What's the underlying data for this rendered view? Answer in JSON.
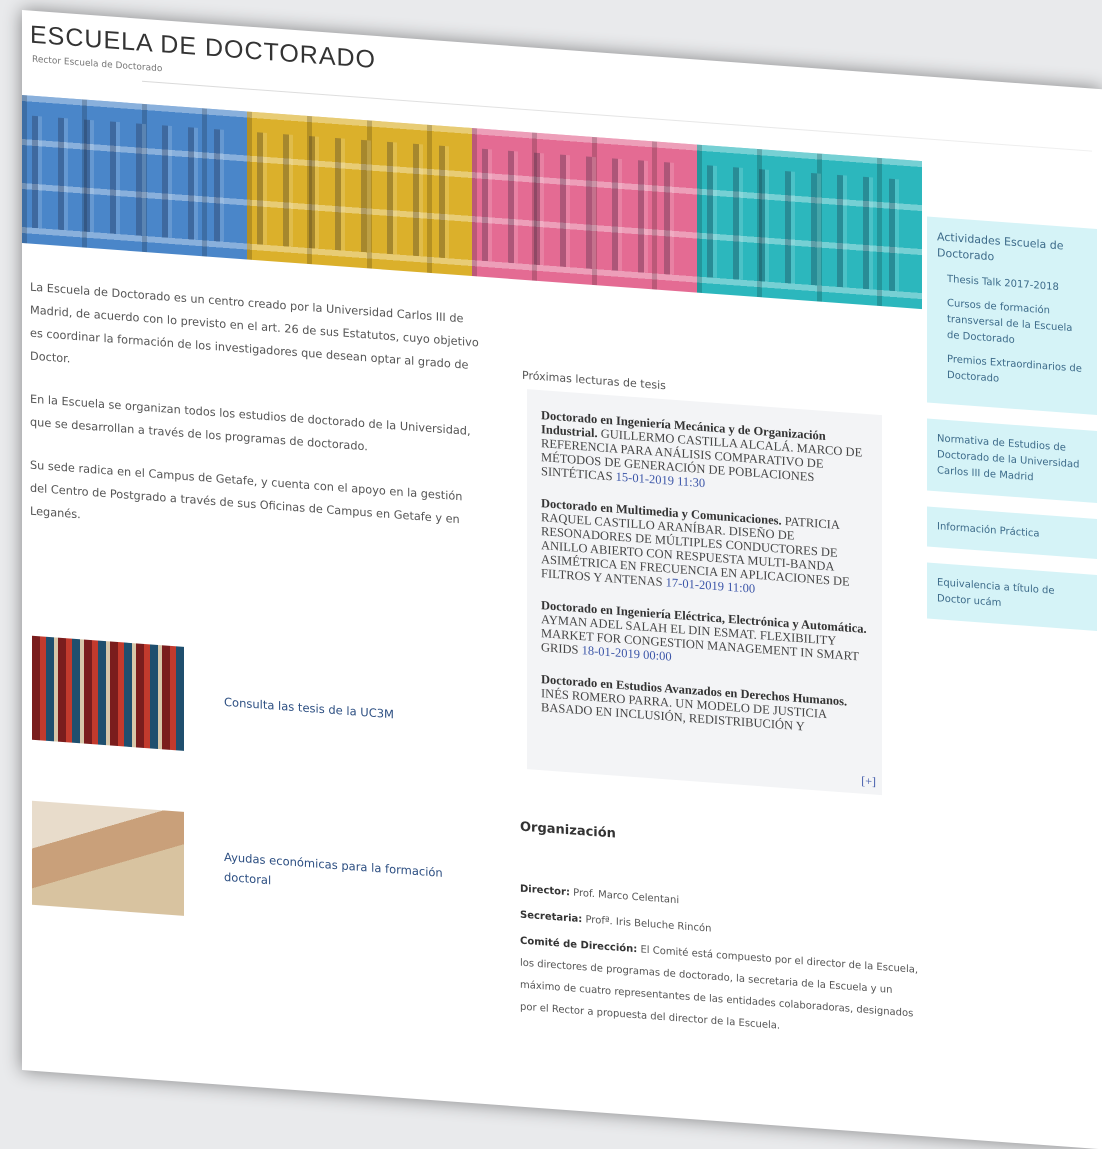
{
  "header": {
    "title": "ESCUELA DE DOCTORADO",
    "subtitle": "Rector Escuela de Doctorado"
  },
  "banner": {
    "colors": [
      "#4a86c9",
      "#dbb02b",
      "#e46b93",
      "#2cb7bd"
    ]
  },
  "intro": {
    "p1": "La Escuela de Doctorado es un centro creado por la Universidad Carlos III de Madrid, de acuerdo con lo previsto en el art. 26 de sus Estatutos, cuyo objetivo es coordinar la formación de los investigadores que desean optar al grado de Doctor.",
    "p2": "En la Escuela se organizan todos los estudios de doctorado de la Universidad, que se desarrollan a través de los programas de doctorado.",
    "p3": "Su sede radica en el Campus de Getafe, y cuenta con el apoyo en la gestión del Centro de Postgrado a través de sus Oficinas de Campus en Getafe y en Leganés."
  },
  "promos": [
    {
      "label": "Consulta las tesis de la UC3M",
      "icon": "library-photo"
    },
    {
      "label": "Ayudas económicas para la formación doctoral",
      "icon": "reading-room-photo"
    }
  ],
  "theses": {
    "title": "Próximas lecturas de tesis",
    "items": [
      {
        "program": "Doctorado en Ingeniería Mecánica y de Organización Industrial.",
        "text": "GUILLERMO CASTILLA ALCALÁ. MARCO DE REFERENCIA PARA ANÁLISIS COMPARATIVO DE MÉTODOS DE GENERACIÓN DE POBLACIONES SINTÉTICAS",
        "date": "15-01-2019 11:30"
      },
      {
        "program": "Doctorado en Multimedia y Comunicaciones.",
        "text": "PATRICIA RAQUEL CASTILLO ARANÍBAR. DISEÑO DE RESONADORES DE MÚLTIPLES CONDUCTORES DE ANILLO ABIERTO CON RESPUESTA MULTI-BANDA ASIMÉTRICA EN FRECUENCIA EN APLICACIONES DE FILTROS Y ANTENAS",
        "date": "17-01-2019 11:00"
      },
      {
        "program": "Doctorado en Ingeniería Eléctrica, Electrónica y Automática.",
        "text": "AYMAN ADEL SALAH EL DIN ESMAT. FLEXIBILITY MARKET FOR CONGESTION MANAGEMENT IN SMART GRIDS",
        "date": "18-01-2019 00:00"
      },
      {
        "program": "Doctorado en Estudios Avanzados en Derechos Humanos.",
        "text": "INÉS ROMERO PARRA. UN MODELO DE JUSTICIA BASADO EN INCLUSIÓN, REDISTRIBUCIÓN Y",
        "date": ""
      }
    ],
    "more": "[+]"
  },
  "organization": {
    "title": "Organización",
    "director_label": "Director:",
    "director": "Prof. Marco Celentani",
    "secretary_label": "Secretaria:",
    "secretary": "Profª. Iris Beluche Rincón",
    "committee_label": "Comité de Dirección:",
    "committee": "El Comité está compuesto por el director de la Escuela, los directores de programas de doctorado, la secretaria de la Escuela y un máximo de cuatro representantes de las entidades colaboradoras, designados por el Rector a propuesta del director de la Escuela."
  },
  "sidebar": {
    "activities_title": "Actividades Escuela de Doctorado",
    "activities": [
      "Thesis Talk 2017-2018",
      "Cursos de formación transversal de la Escuela de Doctorado",
      "Premios Extraordinarios de Doctorado"
    ],
    "normativa": "Normativa de Estudios de Doctorado de la Universidad Carlos III de Madrid",
    "info": "Información Práctica",
    "equivalencia": "Equivalencia a título de Doctor ucám"
  }
}
